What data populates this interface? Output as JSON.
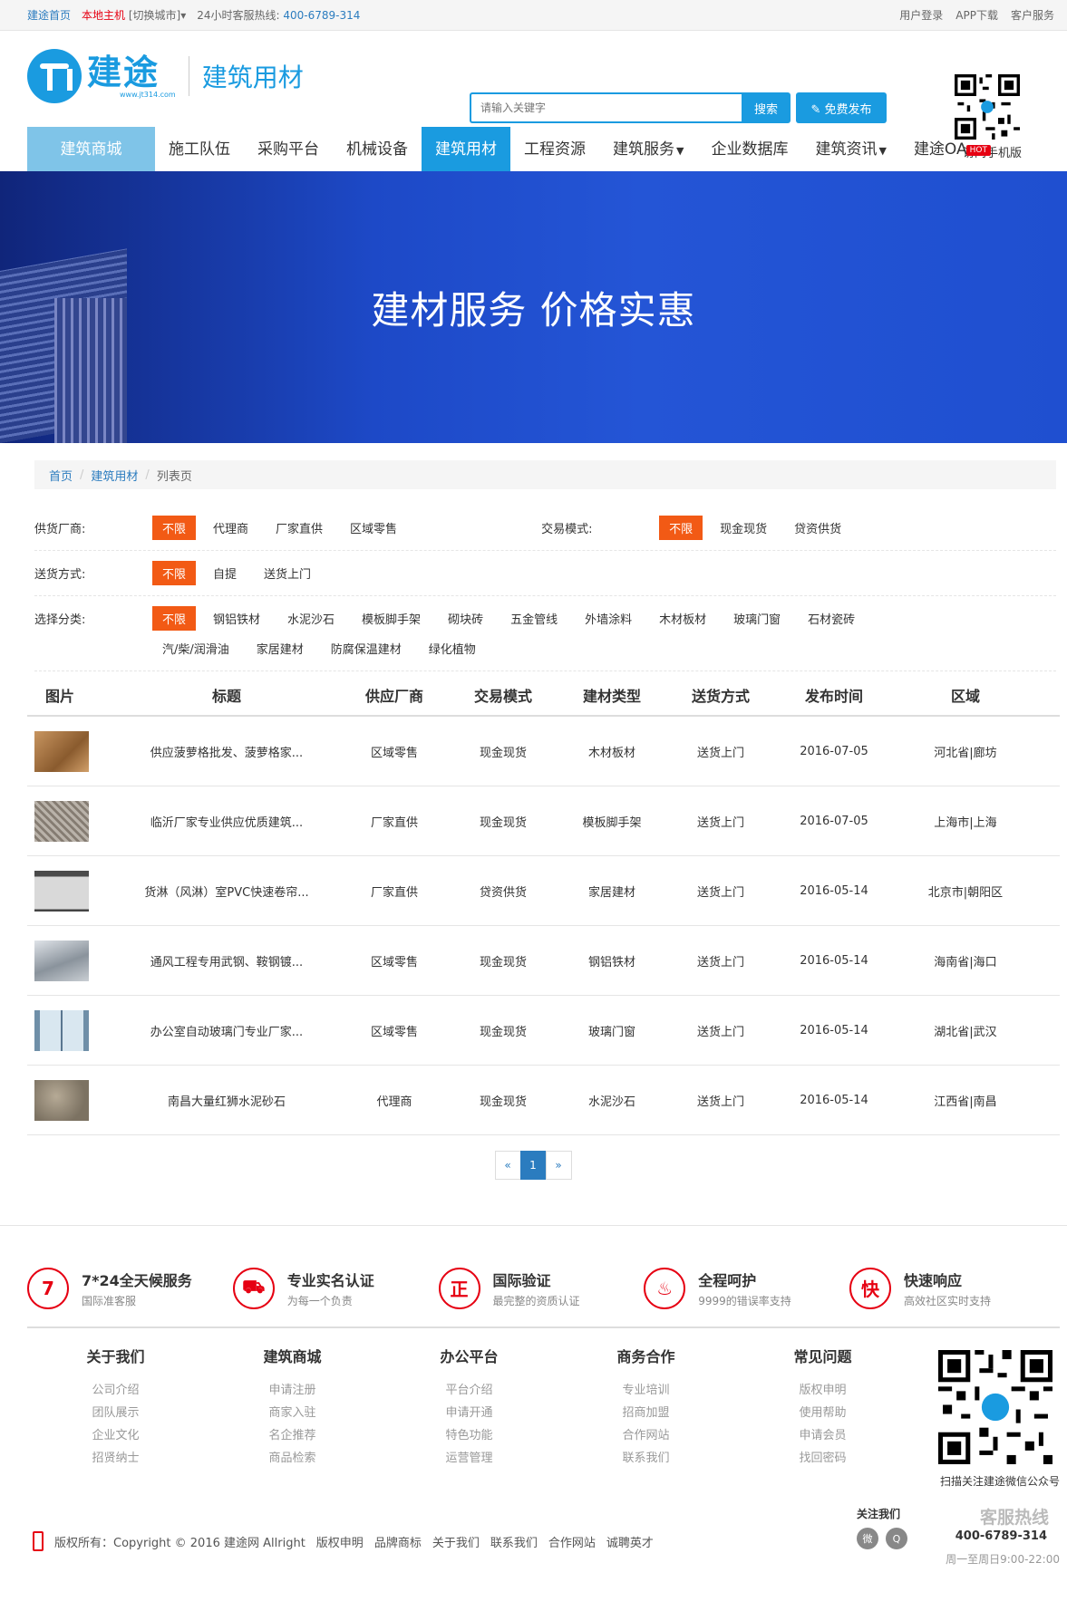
{
  "topbar": {
    "home": "建途首页",
    "city": "本地主机",
    "switch": "[切换城市]▾",
    "hotline_label": "24小时客服热线:",
    "hotline_number": "400-6789-314",
    "links": [
      "用户登录",
      "APP下载",
      "客户服务"
    ]
  },
  "header": {
    "logo_name": "建途",
    "logo_url": "www.jt314.com",
    "logo_sub": "建筑用材",
    "search_placeholder": "请输入关键字",
    "search_button": "搜索",
    "publish_button": "✎ 免费发布",
    "qr_label": "访问手机版",
    "hot_badge": "HOT"
  },
  "nav": {
    "items": [
      "建筑商城",
      "施工队伍",
      "采购平台",
      "机械设备",
      "建筑用材",
      "工程资源",
      "建筑服务",
      "企业数据库",
      "建筑资讯",
      "建途OA"
    ],
    "active": "建筑用材"
  },
  "banner": {
    "title": "建材服务 价格实惠"
  },
  "breadcrumb": {
    "home": "首页",
    "section": "建筑用材",
    "current": "列表页"
  },
  "filters": {
    "supplier": {
      "label": "供货厂商:",
      "options": [
        "不限",
        "代理商",
        "厂家直供",
        "区域零售"
      ]
    },
    "trade": {
      "label": "交易模式:",
      "options": [
        "不限",
        "现金现货",
        "贷资供货"
      ]
    },
    "delivery": {
      "label": "送货方式:",
      "options": [
        "不限",
        "自提",
        "送货上门"
      ]
    },
    "category": {
      "label": "选择分类:",
      "options": [
        "不限",
        "钢铝铁材",
        "水泥沙石",
        "模板脚手架",
        "砌块砖",
        "五金管线",
        "外墙涂料",
        "木材板材",
        "玻璃门窗",
        "石材瓷砖",
        "汽/柴/润滑油",
        "家居建材",
        "防腐保温建材",
        "绿化植物"
      ]
    }
  },
  "table": {
    "headers": [
      "图片",
      "标题",
      "供应厂商",
      "交易模式",
      "建材类型",
      "送货方式",
      "发布时间",
      "区域"
    ],
    "rows": [
      {
        "title": "供应菠萝格批发、菠萝格家...",
        "supplier": "区域零售",
        "mode": "现金现货",
        "type": "木材板材",
        "delivery": "送货上门",
        "date": "2016-07-05",
        "area": "河北省|廊坊"
      },
      {
        "title": "临沂厂家专业供应优质建筑...",
        "supplier": "厂家直供",
        "mode": "现金现货",
        "type": "模板脚手架",
        "delivery": "送货上门",
        "date": "2016-07-05",
        "area": "上海市|上海"
      },
      {
        "title": "货淋（风淋）室PVC快速卷帘...",
        "supplier": "厂家直供",
        "mode": "贷资供货",
        "type": "家居建材",
        "delivery": "送货上门",
        "date": "2016-05-14",
        "area": "北京市|朝阳区"
      },
      {
        "title": "通风工程专用武钢、鞍钢镀...",
        "supplier": "区域零售",
        "mode": "现金现货",
        "type": "钢铝铁材",
        "delivery": "送货上门",
        "date": "2016-05-14",
        "area": "海南省|海口"
      },
      {
        "title": "办公室自动玻璃门专业厂家...",
        "supplier": "区域零售",
        "mode": "现金现货",
        "type": "玻璃门窗",
        "delivery": "送货上门",
        "date": "2016-05-14",
        "area": "湖北省|武汉"
      },
      {
        "title": "南昌大量红狮水泥砂石",
        "supplier": "代理商",
        "mode": "现金现货",
        "type": "水泥沙石",
        "delivery": "送货上门",
        "date": "2016-05-14",
        "area": "江西省|南昌"
      }
    ]
  },
  "pager": {
    "prev": "«",
    "current": "1",
    "next": "»"
  },
  "services": [
    {
      "icon": "7",
      "title": "7*24全天候服务",
      "sub": "国际准客服"
    },
    {
      "icon": "⛟",
      "title": "专业实名认证",
      "sub": "为每一个负责"
    },
    {
      "icon": "正",
      "title": "国际验证",
      "sub": "最完整的资质认证"
    },
    {
      "icon": "♨",
      "title": "全程呵护",
      "sub": "9999的错误率支持"
    },
    {
      "icon": "快",
      "title": "快速响应",
      "sub": "高效社区实时支持"
    }
  ],
  "footer": {
    "columns": [
      {
        "title": "关于我们",
        "links": [
          "公司介绍",
          "团队展示",
          "企业文化",
          "招贤纳士"
        ]
      },
      {
        "title": "建筑商城",
        "links": [
          "申请注册",
          "商家入驻",
          "名企推荐",
          "商品检索"
        ]
      },
      {
        "title": "办公平台",
        "links": [
          "平台介绍",
          "申请开通",
          "特色功能",
          "运营管理"
        ]
      },
      {
        "title": "商务合作",
        "links": [
          "专业培训",
          "招商加盟",
          "合作网站",
          "联系我们"
        ]
      },
      {
        "title": "常见问题",
        "links": [
          "版权申明",
          "使用帮助",
          "申请会员",
          "找回密码"
        ]
      }
    ],
    "qr_label": "扫描关注建途微信公众号",
    "follow": "关注我们",
    "hotline_title": "客服热线",
    "hotline_number": "400-6789-314",
    "hotline_hours": "周一至周日9:00-22:00",
    "copyright": "版权所有：Copyright © 2016 建途网 Allright",
    "bottom_links": [
      "版权申明",
      "品牌商标",
      "关于我们",
      "联系我们",
      "合作网站",
      "诚聘英才"
    ]
  }
}
